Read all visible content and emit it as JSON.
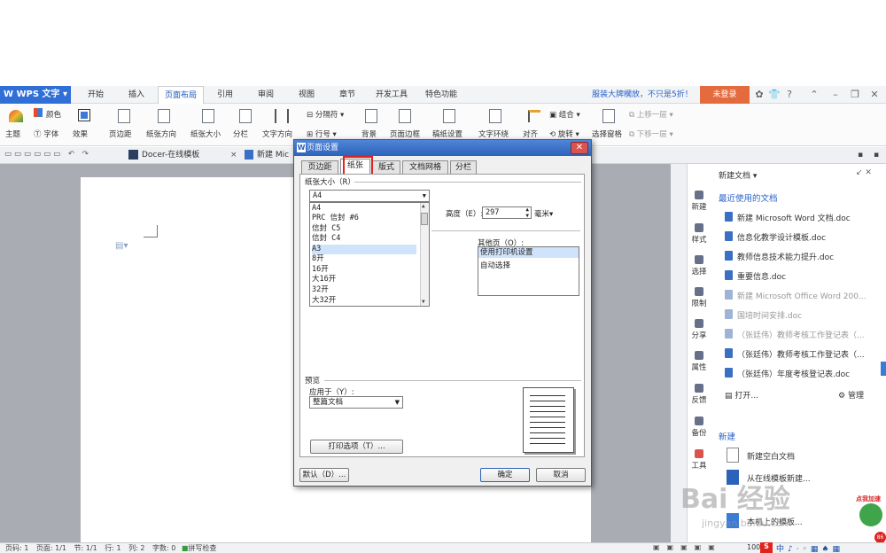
{
  "app": {
    "name": "WPS 文字"
  },
  "menu": {
    "tabs": [
      {
        "label": "开始"
      },
      {
        "label": "插入"
      },
      {
        "label": "页面布局"
      },
      {
        "label": "引用"
      },
      {
        "label": "审阅"
      },
      {
        "label": "视图"
      },
      {
        "label": "章节"
      },
      {
        "label": "开发工具"
      },
      {
        "label": "特色功能"
      }
    ],
    "promo": "服装大牌櫊放，不只是5折！",
    "login": "未登录",
    "help": "?"
  },
  "ribbon": {
    "theme": "主题",
    "color": "颜色",
    "font": "字体",
    "effect": "效果",
    "margin": "页边距",
    "orientation": "纸张方向",
    "size": "纸张大小",
    "columns": "分栏",
    "textdir": "文字方向",
    "linenum": "行号",
    "breaks": "分隔符",
    "background": "背景",
    "border": "页面边框",
    "draft": "稿纸设置",
    "wrap": "文字环绕",
    "align": "对齐",
    "rotate": "旋转",
    "group": "组合",
    "selectpane": "选择窗格",
    "up": "上移一层",
    "down": "下移一层"
  },
  "doctabs": {
    "docer": "Docer-在线模板",
    "newdoc": "新建 Mic"
  },
  "dialog": {
    "title": "页面设置",
    "tabs": [
      {
        "label": "页边距"
      },
      {
        "label": "纸张"
      },
      {
        "label": "版式"
      },
      {
        "label": "文档网格"
      },
      {
        "label": "分栏"
      }
    ],
    "paper_size_label": "纸张大小（R）",
    "selected_size": "A4",
    "size_options": [
      "A4",
      "PRC 信封 #6",
      "信封 C5",
      "信封 C4",
      "A3",
      "8开",
      "16开",
      "大16开",
      "32开",
      "大32开"
    ],
    "height_label": "高度（E）:",
    "height_value": "297",
    "unit": "毫米",
    "other_pages_label": "其他页（O）:",
    "other_pages_options": [
      "使用打印机设置",
      "自动选择"
    ],
    "preview_label": "预览",
    "apply_label": "应用于（Y）:",
    "apply_value": "整篇文档",
    "print_options": "打印选项（T）...",
    "default_btn": "默认（D）...",
    "ok": "确定",
    "cancel": "取消"
  },
  "taskpane": {
    "header": "新建文档",
    "recent_title": "最近使用的文档",
    "recent": [
      "新建 Microsoft Word 文档.doc",
      "信息化教学设计模板.doc",
      "教师信息技术能力提升.doc",
      "重要信息.doc",
      "新建 Microsoft Office Word 200...",
      "国培时间安排.doc",
      "（张廷伟）教师考核工作登记表（...",
      "（张廷伟）教师考核工作登记表（...",
      "（张廷伟）年度考核登记表.doc"
    ],
    "open": "打开...",
    "manage": "管理",
    "new_title": "新建",
    "new_blank": "新建空白文档",
    "from_template": "从在线模板新建...",
    "from_local": "本机上的模板...",
    "watermark": "Bai 经验",
    "watermark_url": "jingyan.baidu.com",
    "badge": "点我加速"
  },
  "sidebar": {
    "items": [
      {
        "label": "新建"
      },
      {
        "label": "样式"
      },
      {
        "label": "选择"
      },
      {
        "label": "限制"
      },
      {
        "label": "分享"
      },
      {
        "label": "属性"
      },
      {
        "label": "反馈"
      },
      {
        "label": "备份"
      },
      {
        "label": "工具"
      }
    ]
  },
  "status": {
    "page": "页码: 1",
    "pages": "页面: 1/1",
    "section": "节: 1/1",
    "row": "行: 1",
    "col": "列: 2",
    "words": "字数: 0",
    "spell": "拼写检查",
    "zoom": "100"
  }
}
